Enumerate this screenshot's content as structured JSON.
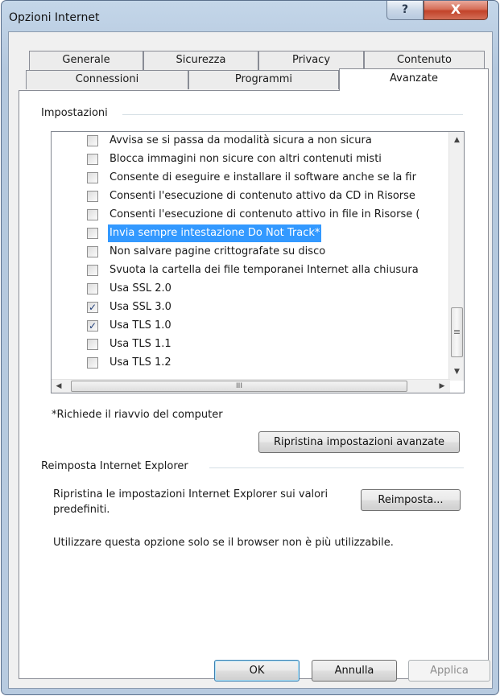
{
  "window": {
    "title": "Opzioni Internet",
    "help_label": "?",
    "close_label": "X"
  },
  "tabs_back": [
    {
      "label": "Generale"
    },
    {
      "label": "Sicurezza"
    },
    {
      "label": "Privacy"
    },
    {
      "label": "Contenuto"
    }
  ],
  "tabs_front": [
    {
      "label": "Connessioni"
    },
    {
      "label": "Programmi"
    },
    {
      "label": "Avanzate",
      "active": true
    }
  ],
  "settings": {
    "group_title": "Impostazioni",
    "items": [
      {
        "label": "Avvisa se si passa da modalità sicura a non sicura",
        "checked": false
      },
      {
        "label": "Blocca immagini non sicure con altri contenuti misti",
        "checked": false
      },
      {
        "label": "Consente di eseguire e installare il software anche se la fir",
        "checked": false
      },
      {
        "label": "Consenti l'esecuzione di contenuto attivo da CD in Risorse",
        "checked": false
      },
      {
        "label": "Consenti l'esecuzione di contenuto attivo in file in Risorse (",
        "checked": false
      },
      {
        "label": "Invia sempre intestazione Do Not Track*",
        "checked": false,
        "selected": true
      },
      {
        "label": "Non salvare pagine crittografate su disco",
        "checked": false
      },
      {
        "label": "Svuota la cartella dei file temporanei Internet alla chiusura",
        "checked": false
      },
      {
        "label": "Usa SSL 2.0",
        "checked": false
      },
      {
        "label": "Usa SSL 3.0",
        "checked": true
      },
      {
        "label": "Usa TLS 1.0",
        "checked": true
      },
      {
        "label": "Usa TLS 1.1",
        "checked": false
      },
      {
        "label": "Usa TLS 1.2",
        "checked": false
      }
    ],
    "check_glyph": "✓",
    "restart_note": "*Richiede il riavvio del computer",
    "restore_button": "Ripristina impostazioni avanzate"
  },
  "reset": {
    "group_title": "Reimposta Internet Explorer",
    "description": "Ripristina le impostazioni Internet Explorer sui valori predefiniti.",
    "button": "Reimposta...",
    "note": "Utilizzare questa opzione solo se il browser non è più utilizzabile."
  },
  "footer": {
    "ok": "OK",
    "cancel": "Annulla",
    "apply": "Applica",
    "apply_enabled": false
  },
  "scrollbar": {
    "up_icon": "▲",
    "down_icon": "▼",
    "left_icon": "◀",
    "right_icon": "▶",
    "thumb_grip": "≡",
    "hthumb_grip": "III"
  }
}
